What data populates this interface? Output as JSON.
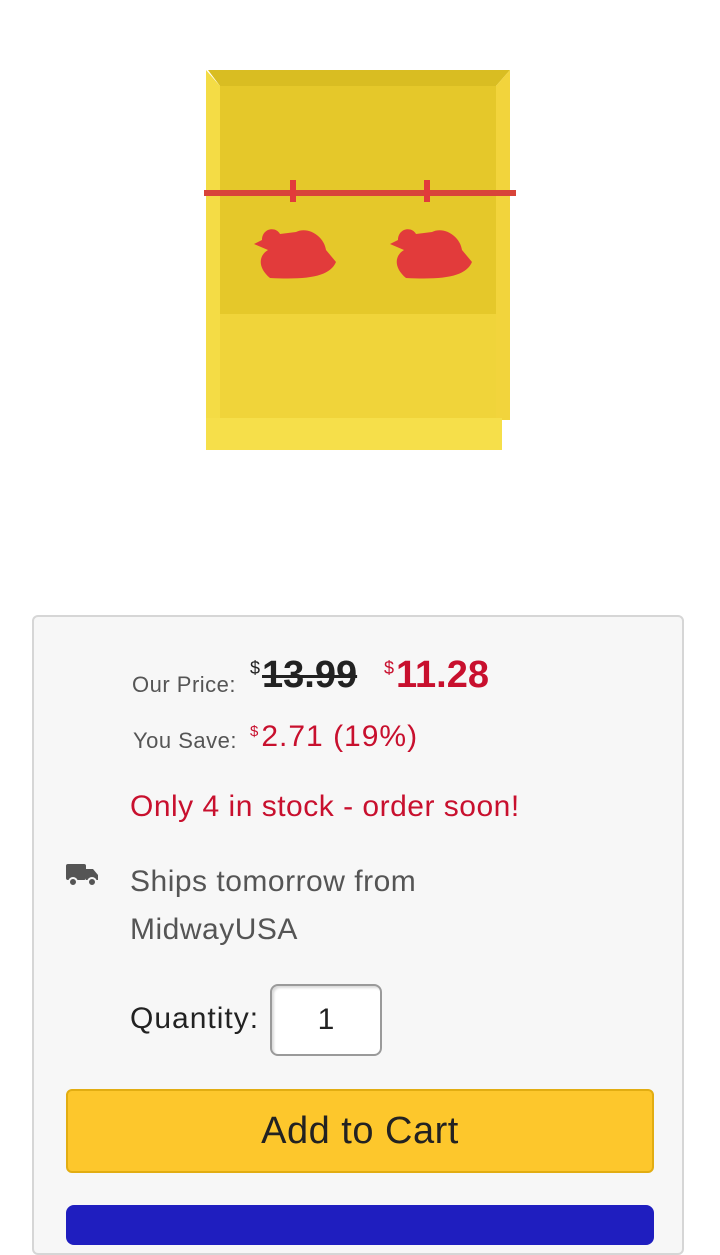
{
  "product": {
    "image_alt": "Yellow steel target box with two red duck targets",
    "colors": {
      "box": "#f2d53a",
      "duck": "#e23b3b"
    }
  },
  "pricing": {
    "our_price_label": "Our Price:",
    "currency_symbol": "$",
    "original_price": "13.99",
    "sale_price": "11.28",
    "you_save_label": "You Save:",
    "savings_amount": "2.71 (19%)"
  },
  "stock": {
    "message": "Only 4 in stock - order soon!"
  },
  "shipping": {
    "icon": "truck-icon",
    "message": "Ships tomorrow from MidwayUSA"
  },
  "quantity": {
    "label": "Quantity:",
    "value": "1"
  },
  "actions": {
    "add_to_cart_label": "Add to Cart"
  },
  "theme": {
    "accent_red": "#c8102e",
    "cart_yellow": "#fdc72c",
    "secondary_blue": "#1f1ebf"
  }
}
